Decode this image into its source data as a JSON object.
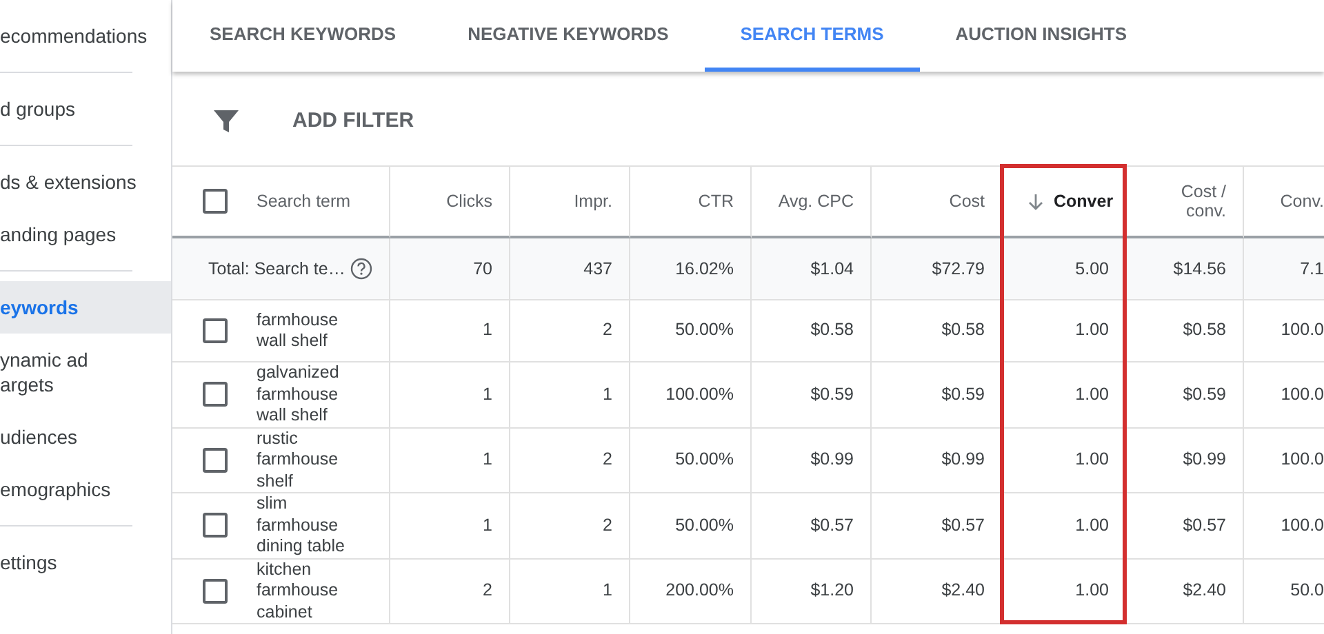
{
  "sidebar": {
    "groups": [
      {
        "items": [
          {
            "label": "ecommendations",
            "selected": false
          }
        ]
      },
      {
        "items": [
          {
            "label": "d groups",
            "selected": false
          }
        ]
      },
      {
        "items": [
          {
            "label": "ds & extensions",
            "selected": false
          },
          {
            "label": "anding pages",
            "selected": false
          }
        ]
      },
      {
        "items": [
          {
            "label": "eywords",
            "selected": true
          },
          {
            "label": "ynamic ad argets",
            "selected": false
          },
          {
            "label": "udiences",
            "selected": false
          },
          {
            "label": "emographics",
            "selected": false
          }
        ]
      },
      {
        "items": [
          {
            "label": "ettings",
            "selected": false
          }
        ]
      }
    ]
  },
  "tabs": [
    {
      "label": "SEARCH KEYWORDS",
      "selected": false
    },
    {
      "label": "NEGATIVE KEYWORDS",
      "selected": false
    },
    {
      "label": "SEARCH TERMS",
      "selected": true
    },
    {
      "label": "AUCTION INSIGHTS",
      "selected": false
    }
  ],
  "filter": {
    "label": "ADD FILTER"
  },
  "table": {
    "header_checkbox": {
      "checked": false
    },
    "columns": [
      {
        "label": "Search term",
        "sorted": false,
        "highlighted": false
      },
      {
        "label": "Clicks",
        "sorted": false,
        "highlighted": false
      },
      {
        "label": "Impr.",
        "sorted": false,
        "highlighted": false
      },
      {
        "label": "CTR",
        "sorted": false,
        "highlighted": false
      },
      {
        "label": "Avg. CPC",
        "sorted": false,
        "highlighted": false
      },
      {
        "label": "Cost",
        "sorted": false,
        "highlighted": false
      },
      {
        "label": "Conver",
        "sorted": true,
        "highlighted": true
      },
      {
        "label": "Cost / conv.",
        "sorted": false,
        "highlighted": false
      },
      {
        "label": "Conv.",
        "sorted": false,
        "highlighted": false
      }
    ],
    "total": {
      "cells": [
        "Total: Search te…",
        "70",
        "437",
        "16.02%",
        "$1.04",
        "$72.79",
        "5.00",
        "$14.56",
        "7.1"
      ]
    },
    "rows": [
      {
        "checked": false,
        "cells": [
          "farmhouse wall shelf",
          "1",
          "2",
          "50.00%",
          "$0.58",
          "$0.58",
          "1.00",
          "$0.58",
          "100.0"
        ]
      },
      {
        "checked": false,
        "cells": [
          "galvanized farmhouse wall shelf",
          "1",
          "1",
          "100.00%",
          "$0.59",
          "$0.59",
          "1.00",
          "$0.59",
          "100.0"
        ]
      },
      {
        "checked": false,
        "cells": [
          "rustic farmhouse shelf",
          "1",
          "2",
          "50.00%",
          "$0.99",
          "$0.99",
          "1.00",
          "$0.99",
          "100.0"
        ]
      },
      {
        "checked": false,
        "cells": [
          "slim farmhouse dining table",
          "1",
          "2",
          "50.00%",
          "$0.57",
          "$0.57",
          "1.00",
          "$0.57",
          "100.0"
        ]
      },
      {
        "checked": false,
        "cells": [
          "kitchen farmhouse cabinet",
          "2",
          "1",
          "200.00%",
          "$1.20",
          "$2.40",
          "1.00",
          "$2.40",
          "50.0"
        ]
      }
    ]
  }
}
